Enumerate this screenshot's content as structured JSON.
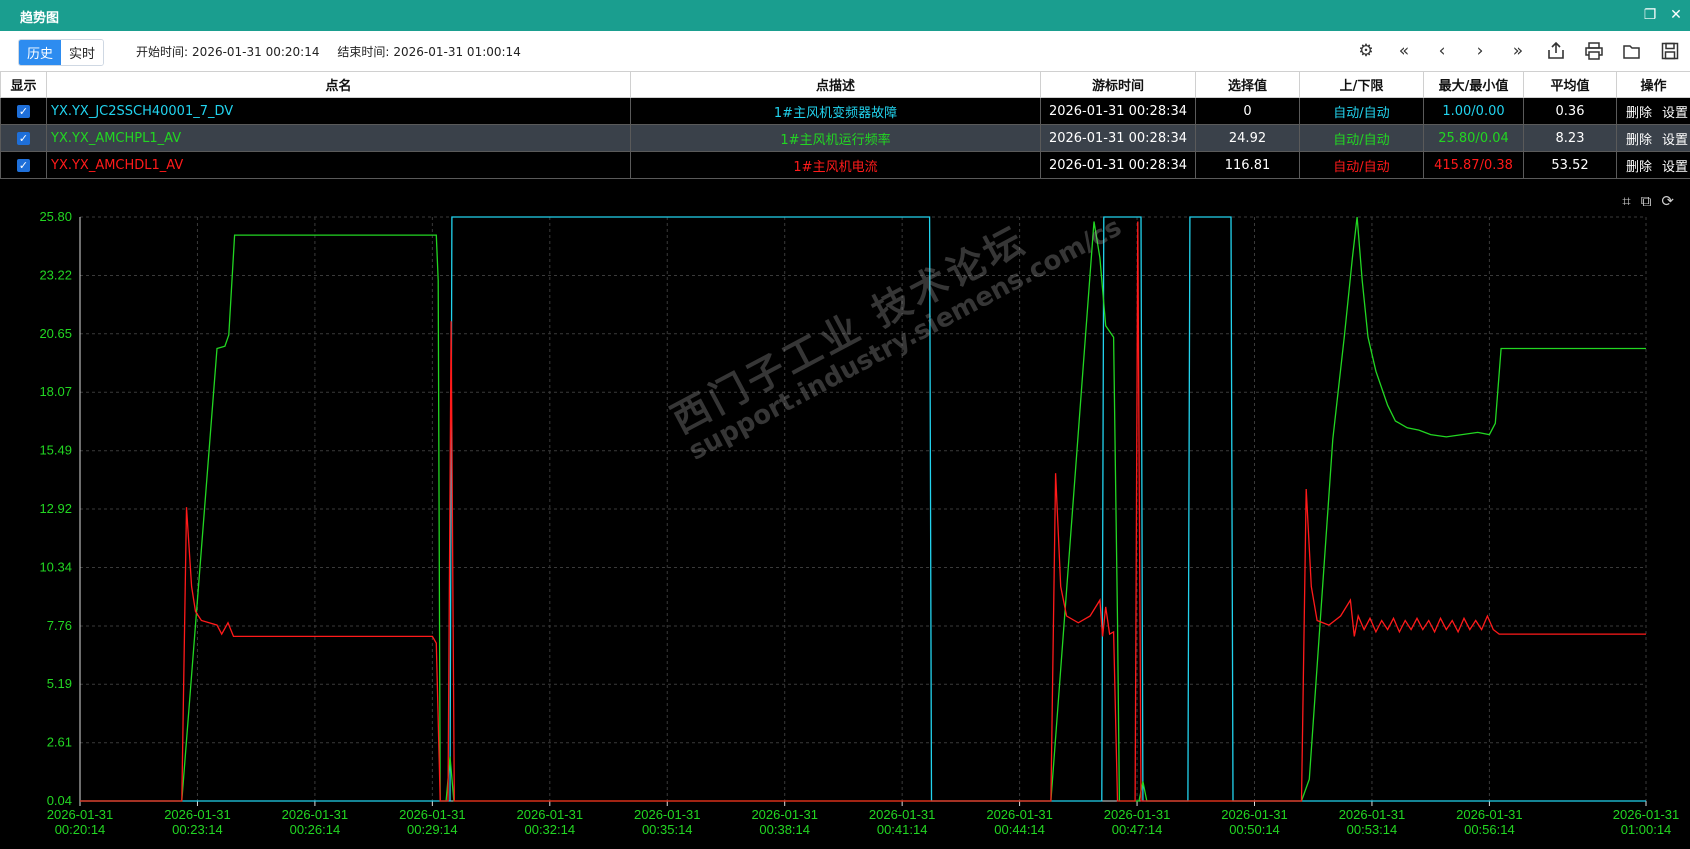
{
  "window": {
    "title": "趋势图"
  },
  "toolbar": {
    "mode_history": "历史",
    "mode_realtime": "实时",
    "start_label": "开始时间:",
    "start_value": "2026-01-31 00:20:14",
    "end_label": "结束时间:",
    "end_value": "2026-01-31 01:00:14"
  },
  "table": {
    "headers": [
      "显示",
      "点名",
      "点描述",
      "游标时间",
      "选择值",
      "上/下限",
      "最大/最小值",
      "平均值",
      "操作"
    ],
    "delete_label": "删除",
    "settings_label": "设置",
    "rows": [
      {
        "name": "YX.YX_JC2SSCH40001_7_DV",
        "desc": "1#主风机变频器故障",
        "cursor_time": "2026-01-31 00:28:34",
        "value": "0",
        "limits": "自动/自动",
        "maxmin": "1.00/0.00",
        "avg": "0.36",
        "color": "#22d3ee"
      },
      {
        "name": "YX.YX_AMCHPL1_AV",
        "desc": "1#主风机运行频率",
        "cursor_time": "2026-01-31 00:28:34",
        "value": "24.92",
        "limits": "自动/自动",
        "maxmin": "25.80/0.04",
        "avg": "8.23",
        "color": "#22d622"
      },
      {
        "name": "YX.YX_AMCHDL1_AV",
        "desc": "1#主风机电流",
        "cursor_time": "2026-01-31 00:28:34",
        "value": "116.81",
        "limits": "自动/自动",
        "maxmin": "415.87/0.38",
        "avg": "53.52",
        "color": "#ff1a1a"
      }
    ]
  },
  "watermark": {
    "line1": "西门子工业 技术论坛",
    "line2": "support.industry.siemens.com/cs"
  },
  "chart_data": {
    "type": "line",
    "ylim": [
      0.04,
      25.8
    ],
    "y_ticks": [
      "25.80",
      "23.22",
      "20.65",
      "18.07",
      "15.49",
      "12.92",
      "10.34",
      "7.76",
      "5.19",
      "2.61",
      "0.04"
    ],
    "x_ticks": [
      [
        "2026-01-31",
        "00:20:14"
      ],
      [
        "2026-01-31",
        "00:23:14"
      ],
      [
        "2026-01-31",
        "00:26:14"
      ],
      [
        "2026-01-31",
        "00:29:14"
      ],
      [
        "2026-01-31",
        "00:32:14"
      ],
      [
        "2026-01-31",
        "00:35:14"
      ],
      [
        "2026-01-31",
        "00:38:14"
      ],
      [
        "2026-01-31",
        "00:41:14"
      ],
      [
        "2026-01-31",
        "00:44:14"
      ],
      [
        "2026-01-31",
        "00:47:14"
      ],
      [
        "2026-01-31",
        "00:50:14"
      ],
      [
        "2026-01-31",
        "00:53:14"
      ],
      [
        "2026-01-31",
        "00:56:14"
      ],
      [
        "2026-01-31",
        "01:00:14"
      ]
    ],
    "x_tick_minutes": [
      0,
      3,
      6,
      9,
      12,
      15,
      18,
      21,
      24,
      27,
      30,
      33,
      36,
      40
    ],
    "x_range_minutes": [
      0,
      40
    ],
    "grid": true,
    "series": [
      {
        "name": "YX.YX_JC2SSCH40001_7_DV",
        "color": "#22d3ee",
        "points": [
          [
            0,
            0.04
          ],
          [
            9.45,
            0.04
          ],
          [
            9.5,
            25.8
          ],
          [
            21.7,
            25.8
          ],
          [
            21.75,
            0.04
          ],
          [
            26.1,
            0.04
          ],
          [
            26.15,
            25.8
          ],
          [
            27.1,
            25.8
          ],
          [
            27.15,
            0.04
          ],
          [
            28.3,
            0.04
          ],
          [
            28.35,
            25.8
          ],
          [
            29.4,
            25.8
          ],
          [
            29.45,
            0.04
          ],
          [
            40,
            0.04
          ]
        ]
      },
      {
        "name": "YX.YX_AMCHPL1_AV",
        "color": "#22d622",
        "points": [
          [
            0,
            0.04
          ],
          [
            2.6,
            0.04
          ],
          [
            3.5,
            20.0
          ],
          [
            3.7,
            20.1
          ],
          [
            3.8,
            20.6
          ],
          [
            3.95,
            25.0
          ],
          [
            9.1,
            25.0
          ],
          [
            9.15,
            23.0
          ],
          [
            9.2,
            0.04
          ],
          [
            9.35,
            0.04
          ],
          [
            9.45,
            2.0
          ],
          [
            9.55,
            0.04
          ],
          [
            24.8,
            0.04
          ],
          [
            25.9,
            25.6
          ],
          [
            26.05,
            24.0
          ],
          [
            26.2,
            21.0
          ],
          [
            26.4,
            20.5
          ],
          [
            26.5,
            8.0
          ],
          [
            26.55,
            0.04
          ],
          [
            27.05,
            0.04
          ],
          [
            27.15,
            0.9
          ],
          [
            27.25,
            0.04
          ],
          [
            31.2,
            0.04
          ],
          [
            31.4,
            1.0
          ],
          [
            32.0,
            16.0
          ],
          [
            32.3,
            20.6
          ],
          [
            32.5,
            24.0
          ],
          [
            32.62,
            25.8
          ],
          [
            32.75,
            23.0
          ],
          [
            32.9,
            20.5
          ],
          [
            33.1,
            19.0
          ],
          [
            33.4,
            17.5
          ],
          [
            33.6,
            16.8
          ],
          [
            33.9,
            16.5
          ],
          [
            34.2,
            16.4
          ],
          [
            34.5,
            16.2
          ],
          [
            34.9,
            16.1
          ],
          [
            35.3,
            16.2
          ],
          [
            35.7,
            16.3
          ],
          [
            36.0,
            16.2
          ],
          [
            36.15,
            16.7
          ],
          [
            36.3,
            20.0
          ],
          [
            40,
            20.0
          ]
        ]
      },
      {
        "name": "YX.YX_AMCHDL1_AV",
        "color": "#ff1a1a",
        "points": [
          [
            0,
            0.04
          ],
          [
            2.6,
            0.04
          ],
          [
            2.72,
            13.0
          ],
          [
            2.85,
            9.5
          ],
          [
            2.95,
            8.4
          ],
          [
            3.1,
            8.0
          ],
          [
            3.3,
            7.9
          ],
          [
            3.5,
            7.8
          ],
          [
            3.62,
            7.4
          ],
          [
            3.78,
            7.9
          ],
          [
            3.92,
            7.3
          ],
          [
            4.1,
            7.3
          ],
          [
            9.0,
            7.3
          ],
          [
            9.1,
            7.0
          ],
          [
            9.2,
            0.04
          ],
          [
            9.4,
            0.04
          ],
          [
            9.48,
            21.2
          ],
          [
            9.56,
            0.04
          ],
          [
            24.8,
            0.04
          ],
          [
            24.92,
            14.5
          ],
          [
            25.05,
            9.5
          ],
          [
            25.2,
            8.2
          ],
          [
            25.5,
            7.9
          ],
          [
            25.8,
            8.2
          ],
          [
            26.05,
            8.9
          ],
          [
            26.12,
            7.3
          ],
          [
            26.2,
            8.6
          ],
          [
            26.3,
            7.4
          ],
          [
            26.4,
            7.5
          ],
          [
            26.5,
            0.04
          ],
          [
            26.95,
            0.04
          ],
          [
            27.02,
            25.6
          ],
          [
            27.1,
            0.04
          ],
          [
            31.2,
            0.04
          ],
          [
            31.32,
            13.8
          ],
          [
            31.45,
            9.5
          ],
          [
            31.6,
            8.0
          ],
          [
            31.9,
            7.8
          ],
          [
            32.2,
            8.2
          ],
          [
            32.45,
            8.9
          ],
          [
            32.55,
            7.3
          ],
          [
            32.65,
            8.2
          ],
          [
            32.8,
            7.6
          ],
          [
            32.95,
            8.1
          ],
          [
            33.1,
            7.5
          ],
          [
            33.25,
            8.0
          ],
          [
            33.4,
            7.6
          ],
          [
            33.55,
            8.1
          ],
          [
            33.7,
            7.5
          ],
          [
            33.85,
            8.0
          ],
          [
            34.0,
            7.6
          ],
          [
            34.15,
            8.1
          ],
          [
            34.3,
            7.6
          ],
          [
            34.45,
            8.0
          ],
          [
            34.6,
            7.5
          ],
          [
            34.75,
            8.1
          ],
          [
            34.9,
            7.6
          ],
          [
            35.05,
            8.0
          ],
          [
            35.2,
            7.5
          ],
          [
            35.35,
            8.1
          ],
          [
            35.5,
            7.6
          ],
          [
            35.65,
            8.0
          ],
          [
            35.8,
            7.6
          ],
          [
            35.95,
            8.2
          ],
          [
            36.1,
            7.6
          ],
          [
            36.25,
            7.4
          ],
          [
            40,
            7.4
          ]
        ]
      }
    ]
  }
}
